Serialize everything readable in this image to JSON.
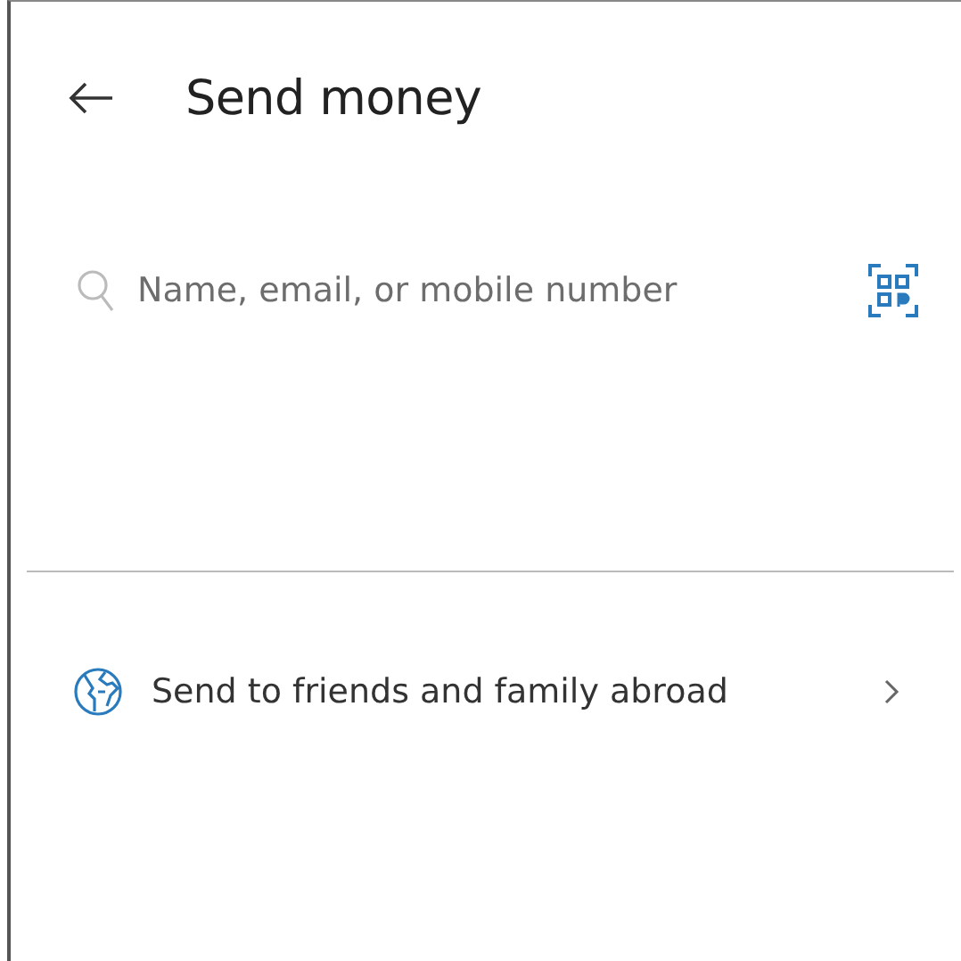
{
  "header": {
    "title": "Send money"
  },
  "search": {
    "placeholder": "Name, email, or mobile number"
  },
  "options": [
    {
      "label": "Send to friends and family abroad"
    }
  ]
}
